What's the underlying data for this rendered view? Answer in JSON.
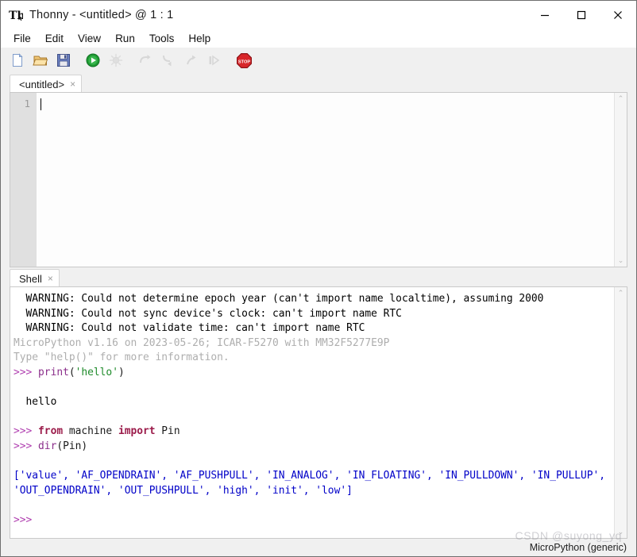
{
  "window": {
    "title": "Thonny  -  <untitled> @  1 : 1",
    "app_icon": "thonny-icon",
    "minimize_label": "—",
    "maximize_label": "□",
    "close_label": "✕"
  },
  "menubar": {
    "items": [
      {
        "label": "File"
      },
      {
        "label": "Edit"
      },
      {
        "label": "View"
      },
      {
        "label": "Run"
      },
      {
        "label": "Tools"
      },
      {
        "label": "Help"
      }
    ]
  },
  "toolbar": {
    "buttons": [
      {
        "name": "new-file-icon",
        "title": "New",
        "enabled": true
      },
      {
        "name": "open-folder-icon",
        "title": "Load",
        "enabled": true
      },
      {
        "name": "save-floppy-icon",
        "title": "Save",
        "enabled": true
      },
      {
        "name": "run-play-icon",
        "title": "Run current script",
        "enabled": true
      },
      {
        "name": "debug-bug-icon",
        "title": "Debug current script",
        "enabled": false
      },
      {
        "name": "step-over-icon",
        "title": "Step over",
        "enabled": false
      },
      {
        "name": "step-into-icon",
        "title": "Step into",
        "enabled": false
      },
      {
        "name": "step-out-icon",
        "title": "Step out",
        "enabled": false
      },
      {
        "name": "resume-icon",
        "title": "Resume",
        "enabled": false
      },
      {
        "name": "stop-icon",
        "title": "Stop/Restart backend",
        "enabled": true
      }
    ]
  },
  "editor": {
    "tab_label": "<untitled>",
    "tab_close": "×",
    "line_numbers": [
      "1"
    ],
    "content": ""
  },
  "shell": {
    "tab_label": "Shell",
    "tab_close": "×",
    "lines": [
      {
        "kind": "warning",
        "segments": [
          {
            "style": "warn",
            "text": "  WARNING: Could not determine epoch year (can't import name localtime), assuming 2000"
          }
        ]
      },
      {
        "kind": "warning",
        "segments": [
          {
            "style": "warn",
            "text": "  WARNING: Could not sync device's clock: can't import name RTC"
          }
        ]
      },
      {
        "kind": "warning",
        "segments": [
          {
            "style": "warn",
            "text": "  WARNING: Could not validate time: can't import name RTC"
          }
        ]
      },
      {
        "kind": "banner",
        "segments": [
          {
            "style": "banner",
            "text": "MicroPython v1.16 on 2023-05-26; ICAR-F5270 with MM32F5277E9P"
          }
        ]
      },
      {
        "kind": "banner",
        "segments": [
          {
            "style": "banner",
            "text": "Type \"help()\" for more information."
          }
        ]
      },
      {
        "kind": "input",
        "segments": [
          {
            "style": "prompt",
            "text": ">>> "
          },
          {
            "style": "fn",
            "text": "print"
          },
          {
            "style": "plain",
            "text": "("
          },
          {
            "style": "str",
            "text": "'hello'"
          },
          {
            "style": "plain",
            "text": ")"
          }
        ]
      },
      {
        "kind": "blank",
        "segments": [
          {
            "style": "plain",
            "text": ""
          }
        ]
      },
      {
        "kind": "output",
        "segments": [
          {
            "style": "out",
            "text": "  hello"
          }
        ]
      },
      {
        "kind": "blank",
        "segments": [
          {
            "style": "plain",
            "text": ""
          }
        ]
      },
      {
        "kind": "input",
        "segments": [
          {
            "style": "prompt",
            "text": ">>> "
          },
          {
            "style": "kw",
            "text": "from"
          },
          {
            "style": "plain",
            "text": " machine "
          },
          {
            "style": "kw",
            "text": "import"
          },
          {
            "style": "plain",
            "text": " Pin"
          }
        ]
      },
      {
        "kind": "input",
        "segments": [
          {
            "style": "prompt",
            "text": ">>> "
          },
          {
            "style": "fn",
            "text": "dir"
          },
          {
            "style": "plain",
            "text": "(Pin)"
          }
        ]
      },
      {
        "kind": "blank",
        "segments": [
          {
            "style": "plain",
            "text": ""
          }
        ]
      },
      {
        "kind": "output",
        "segments": [
          {
            "style": "blue",
            "text": "['value', 'AF_OPENDRAIN', 'AF_PUSHPULL', 'IN_ANALOG', 'IN_FLOATING', 'IN_PULLDOWN', 'IN_PULLUP', 'OUT_OPENDRAIN', 'OUT_PUSHPULL', 'high', 'init', 'low']"
          }
        ]
      },
      {
        "kind": "blank",
        "segments": [
          {
            "style": "plain",
            "text": ""
          }
        ]
      },
      {
        "kind": "input",
        "segments": [
          {
            "style": "prompt",
            "text": ">>>"
          }
        ]
      }
    ]
  },
  "statusbar": {
    "interpreter": "MicroPython (generic)"
  },
  "watermark": {
    "text": "CSDN @suyong_yq"
  },
  "scrollbar": {
    "up_arrow": "⌃",
    "down_arrow": "⌄"
  },
  "colors": {
    "prompt": "#b03fb0",
    "keyword": "#9b1b4a",
    "string": "#1d8a29",
    "function": "#8b2f8b",
    "output_blue": "#0000c8",
    "banner_gray": "#aeaeae",
    "gutter_bg": "#e0e0e0",
    "window_bg": "#f0f0f0"
  }
}
